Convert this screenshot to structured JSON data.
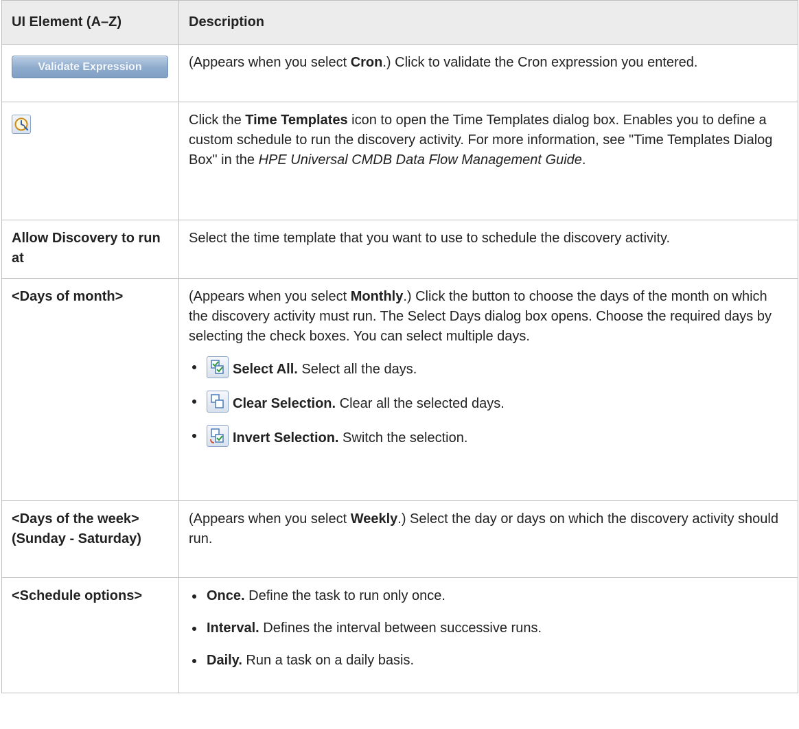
{
  "header": {
    "col1": "UI Element (A–Z)",
    "col2": "Description"
  },
  "rows": {
    "validate": {
      "button_label": "Validate Expression",
      "desc_a": "(Appears when you select ",
      "desc_b": "Cron",
      "desc_c": ".) Click to validate the Cron expression you entered."
    },
    "time_templates": {
      "icon": "clock-icon",
      "desc_a": "Click the ",
      "desc_b": "Time Templates",
      "desc_c": " icon to open the Time Templates dialog box. Enables you to define a custom schedule to run the discovery activity. For more information, see \"Time Templates Dialog Box\" in the ",
      "desc_d": "HPE Universal CMDB Data Flow Management Guide",
      "desc_e": "."
    },
    "allow": {
      "element": "Allow Discovery to run at",
      "desc": "Select the time template that you want to use to schedule the discovery activity."
    },
    "days_month": {
      "element": "<Days of month>",
      "desc_a": "(Appears when you select ",
      "desc_b": "Monthly",
      "desc_c": ".) Click the button to choose the days of the month on which the discovery activity must run. The Select Days dialog box opens. Choose the required days by selecting the check boxes. You can select multiple days.",
      "items": [
        {
          "icon": "select-all-icon",
          "label": "Select All.",
          "text": " Select all the days."
        },
        {
          "icon": "clear-selection-icon",
          "label": "Clear Selection.",
          "text": " Clear all the selected days."
        },
        {
          "icon": "invert-selection-icon",
          "label": "Invert Selection.",
          "text": " Switch the selection."
        }
      ]
    },
    "days_week": {
      "element": "<Days of the week> (Sunday - Saturday)",
      "desc_a": "(Appears when you select ",
      "desc_b": "Weekly",
      "desc_c": ".) Select the day or days on which the discovery activity should run."
    },
    "schedule": {
      "element": "<Schedule options>",
      "items": [
        {
          "label": "Once.",
          "text": " Define the task to run only once."
        },
        {
          "label": "Interval.",
          "text": " Defines the interval between successive runs."
        },
        {
          "label": "Daily.",
          "text": " Run a task on a daily basis."
        }
      ]
    }
  }
}
